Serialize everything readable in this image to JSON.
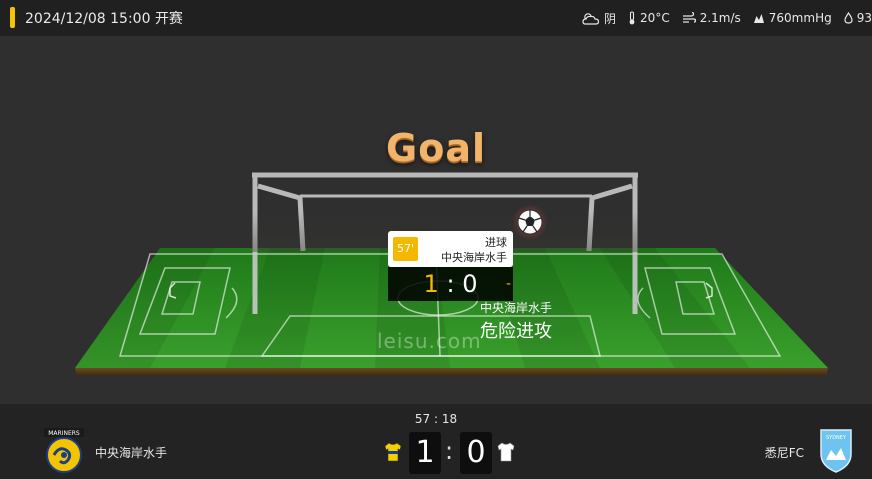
{
  "header": {
    "match_datetime": "2024/12/08 15:00 开赛",
    "weather": {
      "condition": "阴",
      "temperature": "20°C",
      "wind": "2.1m/s",
      "pressure": "760mmHg",
      "humidity": "93"
    }
  },
  "stage": {
    "headline": "Goal",
    "watermark": "leisu.com",
    "event": {
      "minute": "57'",
      "type": "进球",
      "team": "中央海岸水手",
      "score_home": "1",
      "score_sep": ":",
      "score_away": "0",
      "dash": "-"
    },
    "attack": {
      "team": "中央海岸水手",
      "label": "危险进攻"
    }
  },
  "scoreboard": {
    "clock": "57 : 18",
    "home": {
      "name": "中央海岸水手",
      "score": "1",
      "kit_color": "#f5d000",
      "logo_text": "MARINERS"
    },
    "separator": ":",
    "away": {
      "name": "悉尼FC",
      "score": "0",
      "kit_color": "#ffffff",
      "logo_text": "SYDNEY"
    }
  },
  "colors": {
    "accent": "#f5c400",
    "goal_text": "#f1b46a",
    "pitch": "#2f8a22"
  }
}
